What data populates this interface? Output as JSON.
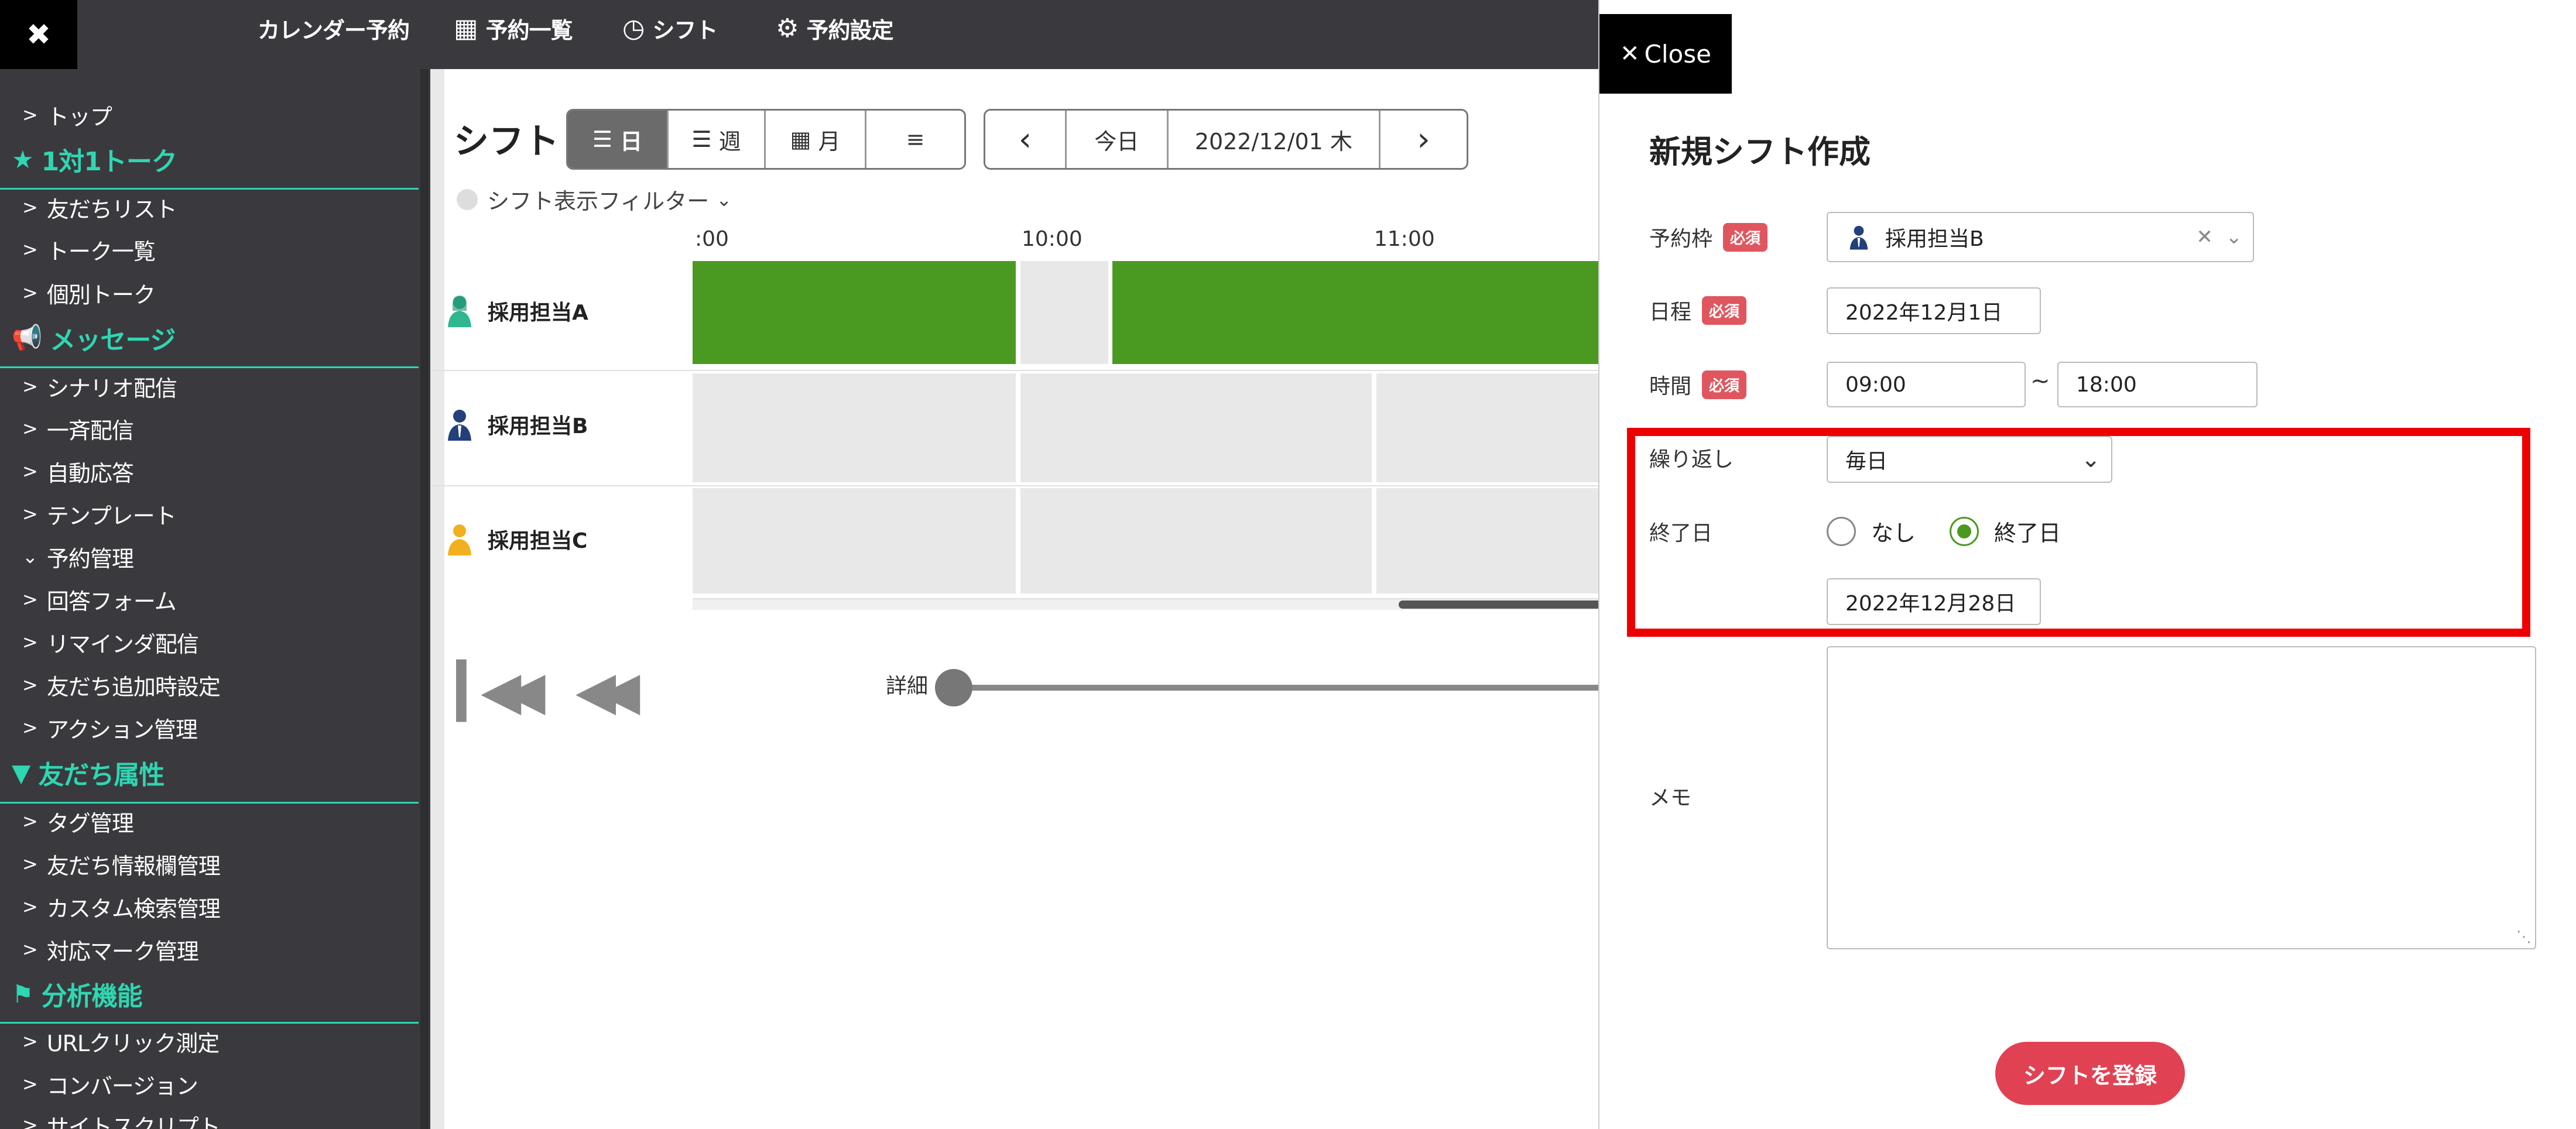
{
  "topbar": {
    "close_icon": "✖",
    "nav": [
      {
        "icon": "",
        "label": "カレンダー予約"
      },
      {
        "icon": "calendar-icon",
        "label": "予約一覧"
      },
      {
        "icon": "clock-icon",
        "label": "シフト"
      },
      {
        "icon": "gear-icon",
        "label": "予約設定"
      }
    ]
  },
  "sidebar": {
    "items": {
      "top": "トップ",
      "friend_list": "友だちリスト",
      "talk_list": "トーク一覧",
      "individual_talk": "個別トーク",
      "scenario": "シナリオ配信",
      "broadcast": "一斉配信",
      "auto_reply": "自動応答",
      "template": "テンプレート",
      "reservation_mgmt": "予約管理",
      "answer_form": "回答フォーム",
      "reminder": "リマインダ配信",
      "friend_add_setting": "友だち追加時設定",
      "action_mgmt": "アクション管理",
      "tag_mgmt": "タグ管理",
      "friend_info_mgmt": "友だち情報欄管理",
      "custom_search_mgmt": "カスタム検索管理",
      "mark_mgmt": "対応マーク管理",
      "url_click": "URLクリック測定",
      "conversion": "コンバージョン",
      "site_script": "サイトスクリプト"
    },
    "heads": {
      "one_on_one": "1対1トーク",
      "message": "メッセージ",
      "friend_attr": "友だち属性",
      "analysis": "分析機能"
    }
  },
  "main": {
    "title": "シフト",
    "view_buttons": {
      "day": "日",
      "week": "週",
      "month": "月",
      "list_icon": "list-icon"
    },
    "nav": {
      "prev": "‹",
      "today": "今日",
      "date": "2022/12/01 木",
      "next": "›"
    },
    "filter_label": "シフト表示フィルター",
    "times": [
      ":00",
      "10:00",
      "11:00"
    ],
    "staff": [
      "採用担当A",
      "採用担当B",
      "採用担当C"
    ],
    "detail_label": "詳細"
  },
  "modal": {
    "close_label": "Close",
    "title": "新規シフト作成",
    "required_badge": "必須",
    "slot": {
      "label": "予約枠",
      "value": "採用担当B"
    },
    "date": {
      "label": "日程",
      "value": "2022年12月1日"
    },
    "time": {
      "label": "時間",
      "start": "09:00",
      "tilde": "~",
      "end": "18:00"
    },
    "repeat": {
      "label": "繰り返し",
      "value": "毎日"
    },
    "end_date": {
      "label": "終了日",
      "option_none": "なし",
      "option_end": "終了日",
      "selected": "終了日",
      "value": "2022年12月28日"
    },
    "memo": {
      "label": "メモ",
      "value": ""
    },
    "submit_label": "シフトを登録"
  },
  "colors": {
    "accent_teal": "#2fd6b2",
    "shift_green": "#4a9a22",
    "required_red": "#e0565f",
    "highlight_red": "#ee0000",
    "submit_red": "#e14253"
  }
}
